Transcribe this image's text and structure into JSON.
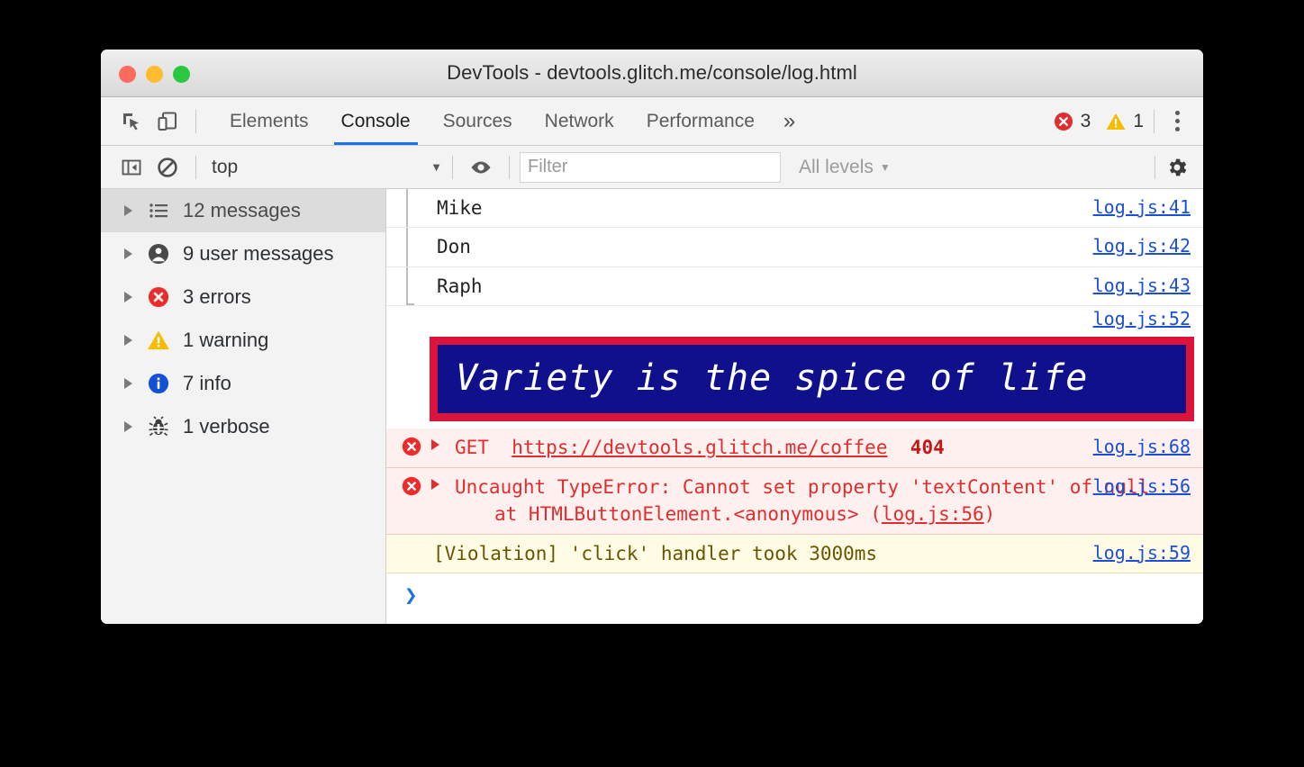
{
  "window": {
    "title": "DevTools - devtools.glitch.me/console/log.html",
    "traffic_lights": [
      {
        "name": "close",
        "color": "#ff6a5e"
      },
      {
        "name": "minimize",
        "color": "#febc2e"
      },
      {
        "name": "zoom",
        "color": "#2ac840"
      }
    ]
  },
  "tabbar": {
    "inspect_icon": "inspect-element-icon",
    "device_icon": "device-toolbar-icon",
    "tabs": [
      {
        "label": "Elements",
        "active": false
      },
      {
        "label": "Console",
        "active": true
      },
      {
        "label": "Sources",
        "active": false
      },
      {
        "label": "Network",
        "active": false
      },
      {
        "label": "Performance",
        "active": false
      }
    ],
    "more_tabs_label": "»",
    "error_count": "3",
    "warning_count": "1",
    "menu_icon": "kebab-menu-icon",
    "accent_color": "#1a73e8",
    "error_color": "#e02e2e",
    "warning_color": "#f5bc00"
  },
  "filterbar": {
    "sidebar_toggle_icon": "show-console-sidebar-icon",
    "clear_icon": "clear-console-icon",
    "context": "top",
    "context_caret": "▼",
    "eye_icon": "live-expression-icon",
    "filter_placeholder": "Filter",
    "filter_value": "",
    "levels_label": "All levels",
    "levels_caret": "▼",
    "settings_icon": "gear-icon"
  },
  "sidebar": {
    "items": [
      {
        "label": "12 messages",
        "icon": "list-icon",
        "selected": true
      },
      {
        "label": "9 user messages",
        "icon": "person-icon",
        "selected": false
      },
      {
        "label": "3 errors",
        "icon": "error-circle-icon",
        "selected": false
      },
      {
        "label": "1 warning",
        "icon": "warning-triangle-icon",
        "selected": false
      },
      {
        "label": "7 info",
        "icon": "info-circle-icon",
        "selected": false
      },
      {
        "label": "1 verbose",
        "icon": "bug-icon",
        "selected": false
      }
    ]
  },
  "console": {
    "entries": [
      {
        "type": "log",
        "text": "Mike",
        "source": "log.js:41",
        "grouped": true
      },
      {
        "type": "log",
        "text": "Don",
        "source": "log.js:42",
        "grouped": true
      },
      {
        "type": "log",
        "text": "Raph",
        "source": "log.js:43",
        "grouped": true
      },
      {
        "type": "styled",
        "text": "Variety is the spice of life",
        "source": "log.js:52",
        "style": {
          "background": "#10108c",
          "border": "#dc143c",
          "color": "#ffffff"
        }
      },
      {
        "type": "error_network",
        "method": "GET",
        "url": "https://devtools.glitch.me/coffee",
        "status": "404",
        "source": "log.js:68"
      },
      {
        "type": "error",
        "line1": "Uncaught TypeError: Cannot set property",
        "line2": "'textContent' of null",
        "line3_pre": "at HTMLButtonElement.<anonymous> (",
        "line3_link": "log.js:56",
        "line3_post": ")",
        "source": "log.js:56"
      },
      {
        "type": "violation",
        "text": "[Violation] 'click' handler took 3000ms",
        "source": "log.js:59"
      }
    ],
    "prompt_chevron": "❯"
  }
}
